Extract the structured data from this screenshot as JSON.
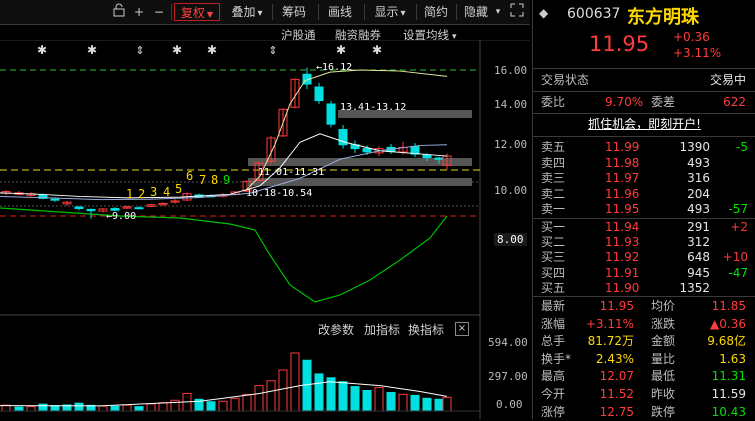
{
  "toolbar": {
    "items": [
      "+",
      "−",
      "复权",
      "叠加",
      "筹码",
      "画线",
      "显示",
      "简约",
      "隐藏"
    ],
    "fuquan_arrow": "▼",
    "overlay_arrow": "▾",
    "display_arrow": "▾"
  },
  "subbar": {
    "hugutong": "沪股通",
    "rongzi": "融资融券",
    "junxian": "设置均线"
  },
  "price_axis": [
    "16.00",
    "14.00",
    "12.00",
    "10.00",
    "8.00"
  ],
  "annotations": {
    "high": "16.12",
    "range1": "13.41-13.12",
    "range2": "11.01-11.31",
    "range3": "10.18-10.54",
    "low": "9.00",
    "counts": [
      "1",
      "2",
      "3",
      "4",
      "5",
      "6",
      "7",
      "8",
      "9"
    ]
  },
  "volume": {
    "buttons": [
      "改参数",
      "加指标",
      "换指标"
    ],
    "axis": [
      "594.00",
      "297.00",
      "0.00"
    ]
  },
  "stock": {
    "code": "600637",
    "name": "东方明珠",
    "price": "11.95",
    "change": "+0.36",
    "pct": "+3.11%"
  },
  "trade_status": {
    "label": "交易状态",
    "value": "交易中"
  },
  "commission": {
    "weibi_label": "委比",
    "weibi": "9.70%",
    "weicha_label": "委差",
    "weicha": "622"
  },
  "ad": "抓住机会，即刻开户!",
  "sell": [
    {
      "label": "卖五",
      "price": "11.99",
      "vol": "1390",
      "chg": "-5"
    },
    {
      "label": "卖四",
      "price": "11.98",
      "vol": "493",
      "chg": ""
    },
    {
      "label": "卖三",
      "price": "11.97",
      "vol": "316",
      "chg": ""
    },
    {
      "label": "卖二",
      "price": "11.96",
      "vol": "204",
      "chg": ""
    },
    {
      "label": "卖一",
      "price": "11.95",
      "vol": "493",
      "chg": "-57"
    }
  ],
  "buy": [
    {
      "label": "买一",
      "price": "11.94",
      "vol": "291",
      "chg": "+2"
    },
    {
      "label": "买二",
      "price": "11.93",
      "vol": "312",
      "chg": ""
    },
    {
      "label": "买三",
      "price": "11.92",
      "vol": "648",
      "chg": "+10"
    },
    {
      "label": "买四",
      "price": "11.91",
      "vol": "945",
      "chg": "-47"
    },
    {
      "label": "买五",
      "price": "11.90",
      "vol": "1352",
      "chg": ""
    }
  ],
  "stats": [
    {
      "l1": "最新",
      "v1": "11.95",
      "c1": "red",
      "l2": "均价",
      "v2": "11.85",
      "c2": "red"
    },
    {
      "l1": "涨幅",
      "v1": "+3.11%",
      "c1": "red",
      "l2": "涨跌",
      "v2": "▲0.36",
      "c2": "red"
    },
    {
      "l1": "总手",
      "v1": "81.72万",
      "c1": "yellow",
      "l2": "金额",
      "v2": "9.68亿",
      "c2": "yellow"
    },
    {
      "l1": "换手*",
      "v1": "2.43%",
      "c1": "yellow",
      "l2": "量比",
      "v2": "1.63",
      "c2": "yellow"
    },
    {
      "l1": "最高",
      "v1": "12.07",
      "c1": "red",
      "l2": "最低",
      "v2": "11.31",
      "c2": "green"
    },
    {
      "l1": "今开",
      "v1": "11.52",
      "c1": "red",
      "l2": "昨收",
      "v2": "11.59",
      "c2": "white"
    },
    {
      "l1": "涨停",
      "v1": "12.75",
      "c1": "red",
      "l2": "跌停",
      "v2": "10.43",
      "c2": "green"
    }
  ],
  "colors": {
    "up": "#ff3b3b",
    "down": "#00e0e0",
    "ma": "#e8e8a0",
    "ma2": "#ffffff",
    "macd": "#00c000",
    "dashed_red": "#e02020",
    "dashed_green": "#30c030",
    "dashed_yellow": "#e0e020"
  }
}
